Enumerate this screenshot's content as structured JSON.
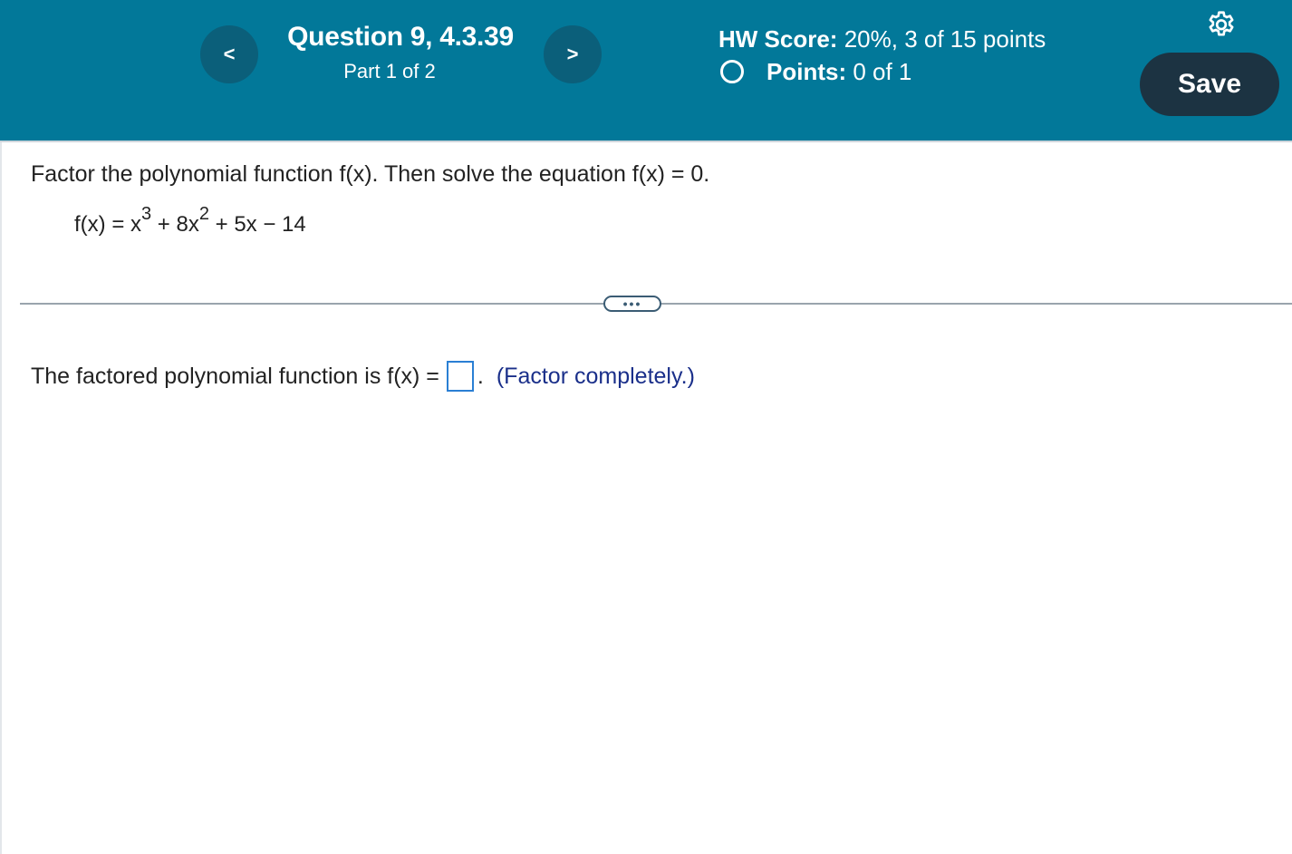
{
  "header": {
    "question_title": "Question 9, 4.3.39",
    "question_part": "Part 1 of 2",
    "prev_label": "<",
    "next_label": ">",
    "hw_score_label": "HW Score:",
    "hw_score_value": "20%, 3 of 15 points",
    "points_label": "Points:",
    "points_value": "0 of 1",
    "save_label": "Save",
    "colors": {
      "header_bg": "#027899",
      "nav_button": "#0b5f7a",
      "save_button": "#1c3342"
    },
    "icons": {
      "settings": "gear-icon",
      "status": "circle-icon"
    }
  },
  "problem": {
    "instruction": "Factor the polynomial function f(x). Then solve the equation f(x) = 0.",
    "equation": {
      "lhs": "f(x) = x",
      "exp1": "3",
      "mid1": " + 8x",
      "exp2": "2",
      "rest": " + 5x − 14"
    }
  },
  "expand_label": "•••",
  "answer": {
    "prompt": "The factored polynomial function is f(x) =",
    "input_value": "",
    "suffix": ".",
    "hint": "(Factor completely.)"
  }
}
